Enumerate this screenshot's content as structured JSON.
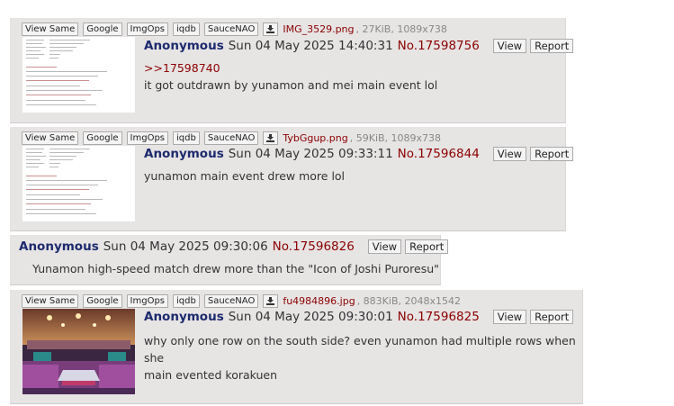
{
  "search_buttons": [
    "View Same",
    "Google",
    "ImgOps",
    "iqdb",
    "SauceNAO"
  ],
  "post_buttons": {
    "view": "View",
    "report": "Report"
  },
  "posts": [
    {
      "file_name": "IMG_3529.png",
      "file_meta": ", 27KiB, 1089x738",
      "name": "Anonymous",
      "date": "Sun 04 May 2025 14:40:31",
      "number": "No.17598756",
      "quote": ">>17598740",
      "text": "it got outdrawn by yunamon and mei main event lol"
    },
    {
      "file_name": "TybGgup.png",
      "file_meta": ", 59KiB, 1089x738",
      "name": "Anonymous",
      "date": "Sun 04 May 2025 09:33:11",
      "number": "No.17596844",
      "text": "yunamon main event drew more lol"
    },
    {
      "name": "Anonymous",
      "date": "Sun 04 May 2025 09:30:06",
      "number": "No.17596826",
      "text": "Yunamon high-speed match drew more than the \"Icon of Joshi Puroresu\""
    },
    {
      "file_name": "fu4984896.jpg",
      "file_meta": ", 883KiB, 2048x1542",
      "name": "Anonymous",
      "date": "Sun 04 May 2025 09:30:01",
      "number": "No.17596825",
      "text_lines": [
        "why only one row on the south side? even yunamon had multiple rows when she",
        "main evented korakuen"
      ]
    }
  ]
}
